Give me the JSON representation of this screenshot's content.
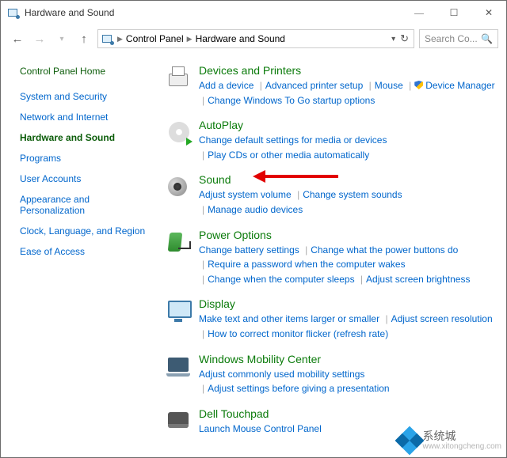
{
  "window": {
    "title": "Hardware and Sound"
  },
  "nav": {
    "breadcrumb": [
      "Control Panel",
      "Hardware and Sound"
    ],
    "searchPlaceholder": "Search Co..."
  },
  "sidebar": {
    "home": "Control Panel Home",
    "items": [
      {
        "label": "System and Security",
        "active": false
      },
      {
        "label": "Network and Internet",
        "active": false
      },
      {
        "label": "Hardware and Sound",
        "active": true
      },
      {
        "label": "Programs",
        "active": false
      },
      {
        "label": "User Accounts",
        "active": false
      },
      {
        "label": "Appearance and Personalization",
        "active": false
      },
      {
        "label": "Clock, Language, and Region",
        "active": false
      },
      {
        "label": "Ease of Access",
        "active": false
      }
    ]
  },
  "categories": [
    {
      "icon": "ic-printer",
      "title": "Devices and Printers",
      "links": [
        {
          "t": "Add a device"
        },
        {
          "t": "Advanced printer setup"
        },
        {
          "t": "Mouse"
        },
        {
          "t": "Device Manager",
          "shield": true
        },
        {
          "t": "Change Windows To Go startup options"
        }
      ]
    },
    {
      "icon": "ic-autoplay",
      "title": "AutoPlay",
      "links": [
        {
          "t": "Change default settings for media or devices"
        },
        {
          "t": "Play CDs or other media automatically"
        }
      ]
    },
    {
      "icon": "ic-sound",
      "title": "Sound",
      "links": [
        {
          "t": "Adjust system volume"
        },
        {
          "t": "Change system sounds"
        },
        {
          "t": "Manage audio devices"
        }
      ]
    },
    {
      "icon": "ic-power",
      "title": "Power Options",
      "links": [
        {
          "t": "Change battery settings"
        },
        {
          "t": "Change what the power buttons do"
        },
        {
          "t": "Require a password when the computer wakes"
        },
        {
          "t": "Change when the computer sleeps"
        },
        {
          "t": "Adjust screen brightness"
        }
      ]
    },
    {
      "icon": "ic-display",
      "title": "Display",
      "links": [
        {
          "t": "Make text and other items larger or smaller"
        },
        {
          "t": "Adjust screen resolution"
        },
        {
          "t": "How to correct monitor flicker (refresh rate)"
        }
      ]
    },
    {
      "icon": "ic-mobility",
      "title": "Windows Mobility Center",
      "links": [
        {
          "t": "Adjust commonly used mobility settings"
        },
        {
          "t": "Adjust settings before giving a presentation"
        }
      ]
    },
    {
      "icon": "ic-touchpad",
      "title": "Dell Touchpad",
      "links": [
        {
          "t": "Launch Mouse Control Panel"
        }
      ]
    }
  ],
  "watermark": {
    "brand": "系统城",
    "url": "www.xitongcheng.com"
  }
}
